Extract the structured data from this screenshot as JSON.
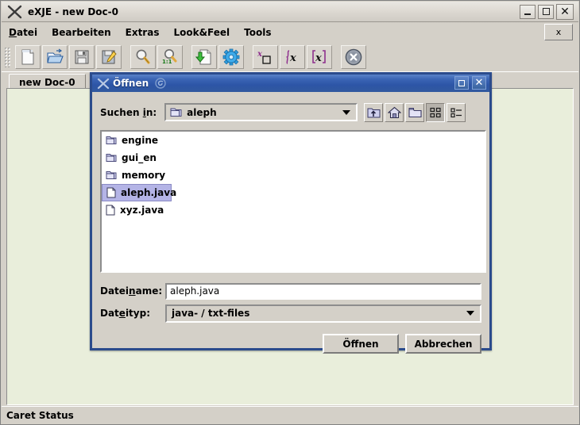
{
  "window": {
    "title": "eXJE - new Doc-0",
    "logo_icon": "x-logo-icon",
    "controls": {
      "minimize": "minimize-icon",
      "maximize": "maximize-icon",
      "close": "close-icon"
    }
  },
  "menubar": {
    "items": [
      {
        "label": "Datei",
        "mnemonic": "D"
      },
      {
        "label": "Bearbeiten",
        "mnemonic": ""
      },
      {
        "label": "Extras",
        "mnemonic": ""
      },
      {
        "label": "Look&Feel",
        "mnemonic": ""
      },
      {
        "label": "Tools",
        "mnemonic": ""
      }
    ],
    "close_tab_label": "x"
  },
  "toolbar": {
    "buttons": [
      {
        "name": "new-document-button",
        "icon": "new-document-icon"
      },
      {
        "name": "open-folder-button",
        "icon": "open-folder-icon"
      },
      {
        "name": "save-button",
        "icon": "floppy-disk-icon"
      },
      {
        "name": "save-as-button",
        "icon": "floppy-pencil-icon"
      },
      {
        "name": "zoom-button",
        "icon": "magnifier-icon"
      },
      {
        "name": "zoom-actual-size-button",
        "icon": "magnifier-1-1-icon"
      },
      {
        "name": "import-document-button",
        "icon": "document-down-arrow-icon"
      },
      {
        "name": "settings-button",
        "icon": "blue-gear-icon"
      },
      {
        "name": "superscript-button",
        "icon": "x-superscript-box-icon"
      },
      {
        "name": "integral-button",
        "icon": "integral-x-icon"
      },
      {
        "name": "bracket-x-button",
        "icon": "bracket-x-icon"
      },
      {
        "name": "close-document-button",
        "icon": "gray-x-circle-icon"
      }
    ]
  },
  "tabs": [
    {
      "label": "new Doc-0",
      "active": true
    }
  ],
  "statusbar": {
    "text": "Caret Status"
  },
  "dialog": {
    "title": "Öffnen",
    "logo_icon": "x-logo-icon",
    "decor_icon": "swirl-icon",
    "controls": {
      "maximize": "maximize-icon",
      "close": "close-icon"
    },
    "lookin": {
      "label": "Suchen in:",
      "mnemonic": "i",
      "value": "aleph",
      "icon": "folder-icon"
    },
    "nav_buttons": [
      {
        "name": "up-one-level-button",
        "icon": "folder-up-arrow-icon",
        "pressed": false
      },
      {
        "name": "home-button",
        "icon": "home-icon",
        "pressed": false
      },
      {
        "name": "create-new-folder-button",
        "icon": "new-folder-icon",
        "pressed": false
      },
      {
        "name": "tiles-view-button",
        "icon": "tiles-view-icon",
        "pressed": true
      },
      {
        "name": "details-view-button",
        "icon": "details-view-icon",
        "pressed": false
      }
    ],
    "files": [
      {
        "name": "engine",
        "type": "folder",
        "selected": false
      },
      {
        "name": "gui_en",
        "type": "folder",
        "selected": false
      },
      {
        "name": "memory",
        "type": "folder",
        "selected": false
      },
      {
        "name": "aleph.java",
        "type": "file",
        "selected": true
      },
      {
        "name": "xyz.java",
        "type": "file",
        "selected": false
      }
    ],
    "filename": {
      "label": "Dateiname:",
      "mnemonic": "n",
      "value": "aleph.java"
    },
    "filetype": {
      "label": "Dateityp:",
      "mnemonic": "e",
      "value": "java- / txt-files"
    },
    "buttons": {
      "open": "Öffnen",
      "cancel": "Abbrechen"
    }
  },
  "colors": {
    "window_bg": "#d4d0c8",
    "editor_bg": "#e9eedb",
    "dialog_border": "#2b4b8c",
    "title_blue": "#2d55a6",
    "selection": "#b4b4e6"
  }
}
